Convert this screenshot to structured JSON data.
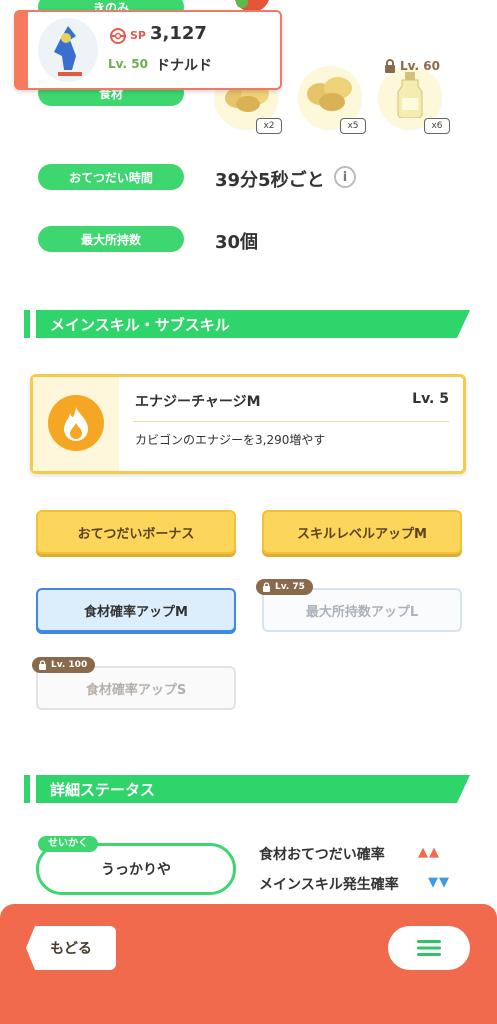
{
  "header": {
    "sp_label": "SP",
    "sp_value": "3,127",
    "level": "Lv. 50",
    "pokemon_name": "ドナルド"
  },
  "labels": {
    "berry": "きのみ",
    "ingredient": "食材",
    "help_time": "おてつだい時間",
    "max_carry": "最大所持数"
  },
  "ingredients": [
    {
      "qty": "x2"
    },
    {
      "qty": "x5"
    },
    {
      "qty": "x6",
      "lock_level": "Lv. 60"
    }
  ],
  "help_time_value": "39分5秒ごと",
  "max_carry_value": "30個",
  "main_skill_section": {
    "title": "メインスキル・サブスキル",
    "skill_name": "エナジーチャージM",
    "skill_level": "Lv. 5",
    "skill_desc": "カビゴンのエナジーを3,290増やす"
  },
  "subskills": [
    {
      "label": "おてつだいボーナス",
      "state": "yellow"
    },
    {
      "label": "スキルレベルアップM",
      "state": "yellow"
    },
    {
      "label": "食材確率アップM",
      "state": "blue"
    },
    {
      "label": "最大所持数アップL",
      "state": "locked",
      "lock_level": "Lv. 75"
    },
    {
      "label": "食材確率アップS",
      "state": "locked",
      "lock_level": "Lv. 100"
    }
  ],
  "details_section": {
    "title": "詳細ステータス",
    "nature_tag": "せいかく",
    "nature_value": "うっかりや",
    "stat1_label": "食材おてつだい確率",
    "stat1_arrows": "▲▲",
    "stat2_label": "メインスキル発生確率",
    "stat2_arrows": "▼▼"
  },
  "bottom": {
    "back_label": "もどる"
  },
  "colors": {
    "green": "#2fd46a",
    "orange": "#f26a4e",
    "yellow": "#fbd65a",
    "blue": "#3f8ae0"
  }
}
